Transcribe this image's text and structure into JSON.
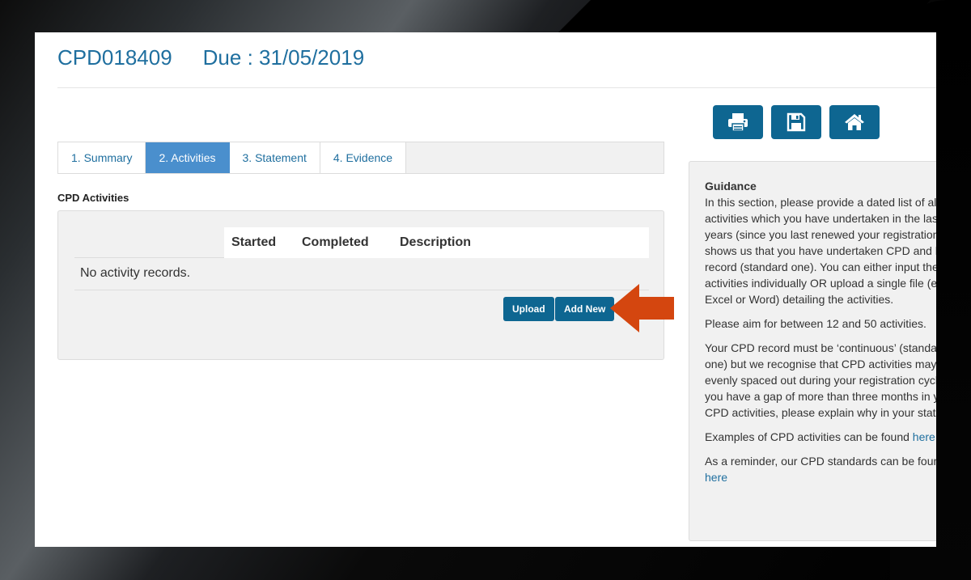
{
  "header": {
    "record_id": "CPD018409",
    "due_text": "Due : 31/05/2019"
  },
  "toolbar": {
    "print_icon": "printer-icon",
    "save_icon": "floppy-disk-icon",
    "home_icon": "home-icon"
  },
  "tabs": [
    {
      "label": "1. Summary",
      "active": false
    },
    {
      "label": "2. Activities",
      "active": true
    },
    {
      "label": "3. Statement",
      "active": false
    },
    {
      "label": "4. Evidence",
      "active": false
    }
  ],
  "activities": {
    "section_label": "CPD Activities",
    "columns": [
      "Started",
      "Completed",
      "Description"
    ],
    "empty_message": "No activity records.",
    "upload_label": "Upload",
    "add_new_label": "Add New"
  },
  "guidance": {
    "title": "Guidance",
    "p1": "In this section, please provide a dated list of all CPD activities which you have undertaken in the last two years (since you last renewed your registration). This shows us that you have undertaken CPD and kept a record (standard one). You can either input the activities individually OR upload a single file (eg pdf, Excel or Word) detailing the activities.",
    "p2": "Please aim for between 12 and 50 activities.",
    "p3": "Your CPD record must be ‘continuous’ (standard one) but we recognise that CPD activities may not be evenly spaced out during your registration cycle. If you have a gap of more than three months in your CPD activities, please explain why in your statement.",
    "p4_text": "Examples of CPD activities can be found ",
    "p4_link": "here",
    "p5_text": "As a reminder, our CPD standards can be found ",
    "p5_link": "here"
  },
  "colors": {
    "brand_blue": "#0e6691",
    "active_tab": "#4a8fcd",
    "title_blue": "#1f6f9f",
    "arrow_orange": "#d4460f"
  }
}
